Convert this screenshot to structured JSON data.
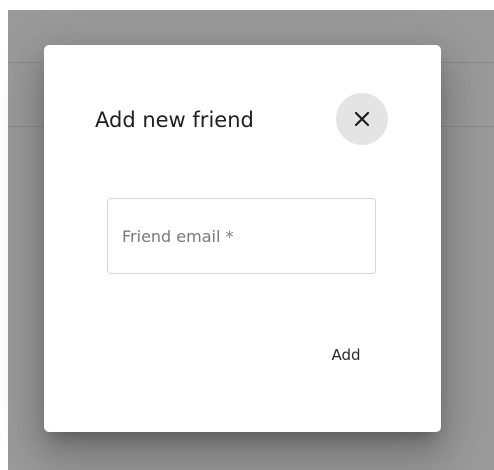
{
  "dialog": {
    "title": "Add new friend",
    "close_icon": "close-icon",
    "email_field": {
      "placeholder": "Friend email *",
      "value": ""
    },
    "add_label": "Add"
  },
  "colors": {
    "backdrop": "#9a9a9a",
    "dialog_background": "#ffffff",
    "close_button_background": "#e4e4e4",
    "text": "#1e1e1e"
  }
}
